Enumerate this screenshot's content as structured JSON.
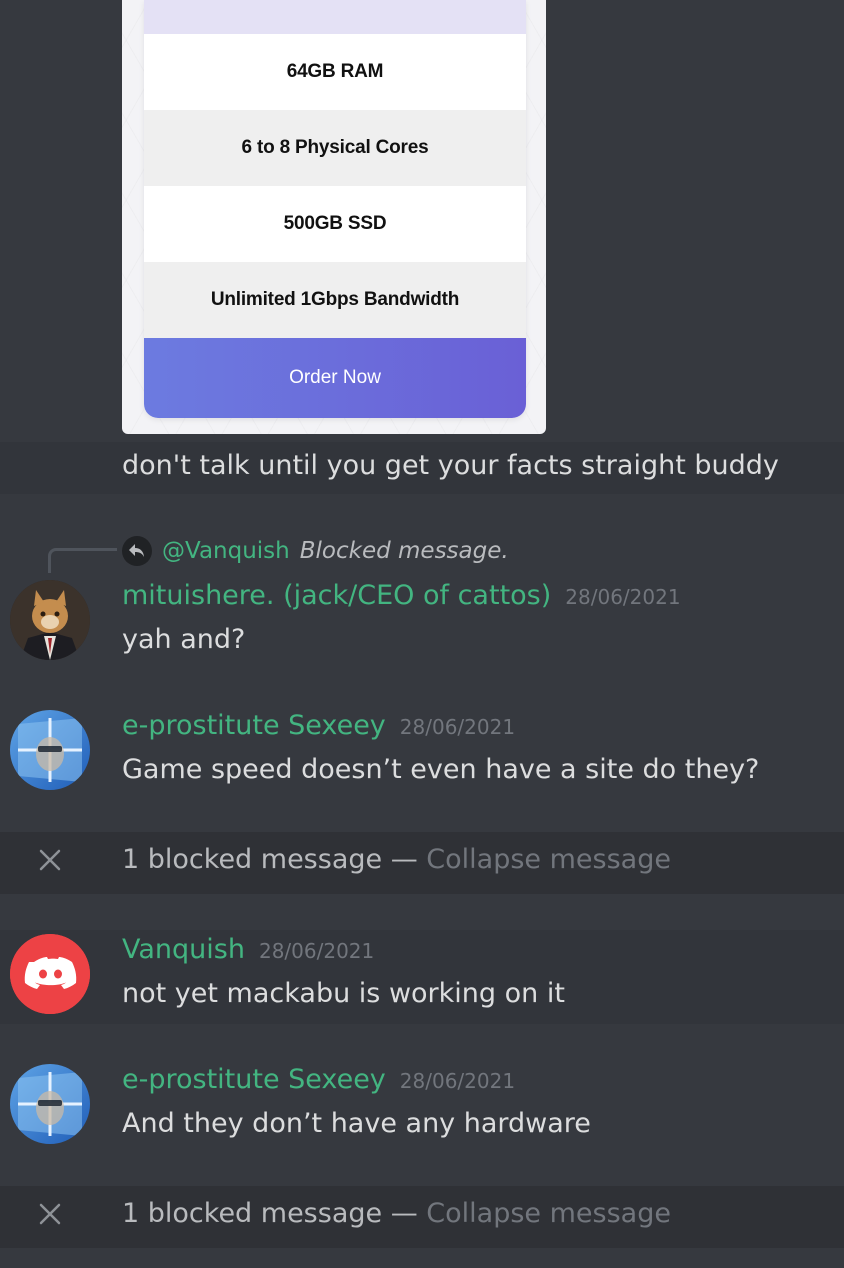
{
  "embed": {
    "rows": [
      "64GB RAM",
      "6 to 8 Physical Cores",
      "500GB SSD",
      "Unlimited 1Gbps Bandwidth"
    ],
    "order_label": "Order Now"
  },
  "continuation": {
    "text": "don't talk until you get your facts straight buddy"
  },
  "reply": {
    "mention": "@Vanquish",
    "blocked_text": "Blocked message."
  },
  "messages": [
    {
      "username": "mituishere. (jack/CEO of cattos)",
      "timestamp": "28/06/2021",
      "text": "yah and?"
    },
    {
      "username": "e-prostitute Sexeey",
      "timestamp": "28/06/2021",
      "text": "Game speed doesn’t even have a site do they?"
    },
    {
      "username": "Vanquish",
      "timestamp": "28/06/2021",
      "text": "not yet mackabu is working on it"
    },
    {
      "username": "e-prostitute Sexeey",
      "timestamp": "28/06/2021",
      "text": "And they don’t have any hardware"
    }
  ],
  "blocked": [
    {
      "count_text": "1 blocked message —",
      "collapse_label": "Collapse message"
    },
    {
      "count_text": "1 blocked message —",
      "collapse_label": "Collapse message"
    }
  ],
  "colors": {
    "background": "#36393f",
    "username": "#43b581",
    "text": "#dcddde",
    "timestamp": "#72767d",
    "discord_red": "#ed4245",
    "order_button": "#6a60d6"
  }
}
